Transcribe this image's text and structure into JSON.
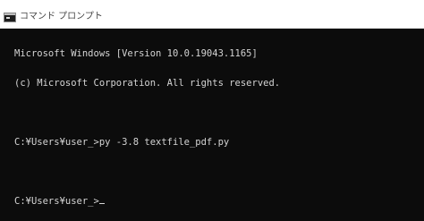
{
  "window": {
    "title": "コマンド プロンプト",
    "icon": "command-prompt-icon",
    "background_color": "#0c0c0c",
    "text_color": "#d4d4d4",
    "title_bar_color": "#ffffff"
  },
  "console": {
    "lines": [
      "Microsoft Windows [Version 10.0.19043.1165]",
      "(c) Microsoft Corporation. All rights reserved.",
      "",
      "C:¥Users¥user_>py -3.8 textfile_pdf.py",
      "",
      "C:¥Users¥user_>"
    ]
  }
}
